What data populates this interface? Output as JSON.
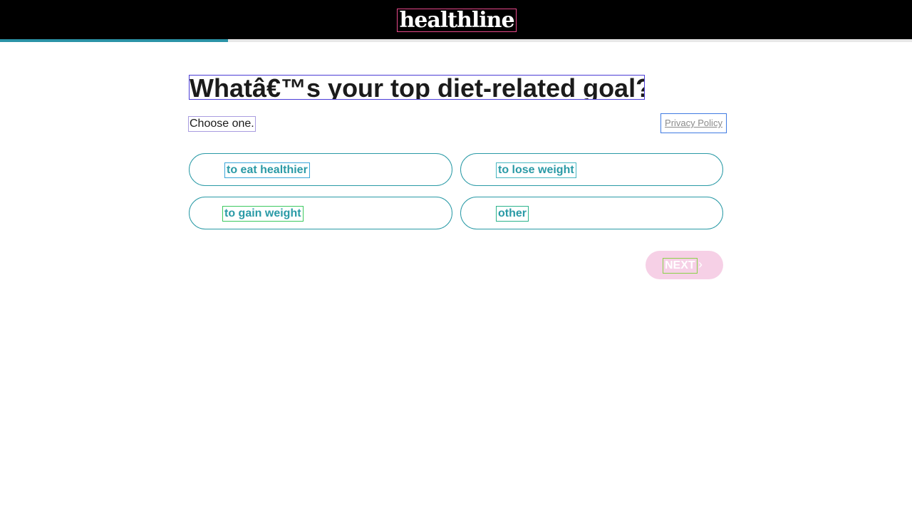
{
  "header": {
    "logo_text": "healthline",
    "background_color": "#000000",
    "progress_fraction": 0.25,
    "progress_color": "#2b93a6"
  },
  "question": {
    "title": "Whatâ€™s your top diet-related goal?",
    "instruction": "Choose one.",
    "privacy_link": "Privacy Policy"
  },
  "options": [
    {
      "label": "to eat healthier"
    },
    {
      "label": "to lose weight"
    },
    {
      "label": "to gain weight"
    },
    {
      "label": "other"
    }
  ],
  "next_button": {
    "label": "NEXT",
    "icon": "chevron-right-icon",
    "background_color": "#f6d0e6"
  },
  "accent_color": "#2a9aa6"
}
